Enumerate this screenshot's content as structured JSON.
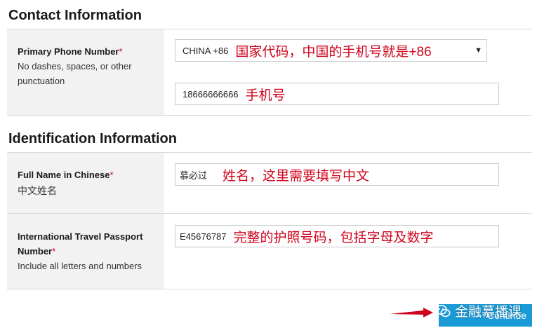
{
  "contact": {
    "title": "Contact Information",
    "phone_label": "Primary Phone Number",
    "required_mark": "*",
    "phone_help_1": "No dashes, spaces, or other",
    "phone_help_2": "punctuation",
    "country_value": "CHINA +86",
    "country_note": "国家代码，中国的手机号就是+86",
    "phone_value": "18666666666",
    "phone_note": "手机号"
  },
  "identification": {
    "title": "Identification Information",
    "fullname_label": "Full Name in Chinese",
    "fullname_help": "中文姓名",
    "fullname_value": "慕必过",
    "fullname_note": "姓名，这里需要填写中文",
    "passport_label_1": "International Travel Passport",
    "passport_label_2": "Number",
    "passport_help": "Include all letters and numbers",
    "passport_value": "E45676787",
    "passport_note": "完整的护照号码，包括字母及数字"
  },
  "footer": {
    "continue_label": "Continue",
    "watermark_text": "金融慕播课",
    "watermark_icon": "wechat-icon",
    "arrow_color": "#d0021b"
  },
  "colors": {
    "required": "#d0021b",
    "annotation": "#d0021b",
    "button": "#1a9ad6",
    "label_bg": "#f2f2f2"
  }
}
